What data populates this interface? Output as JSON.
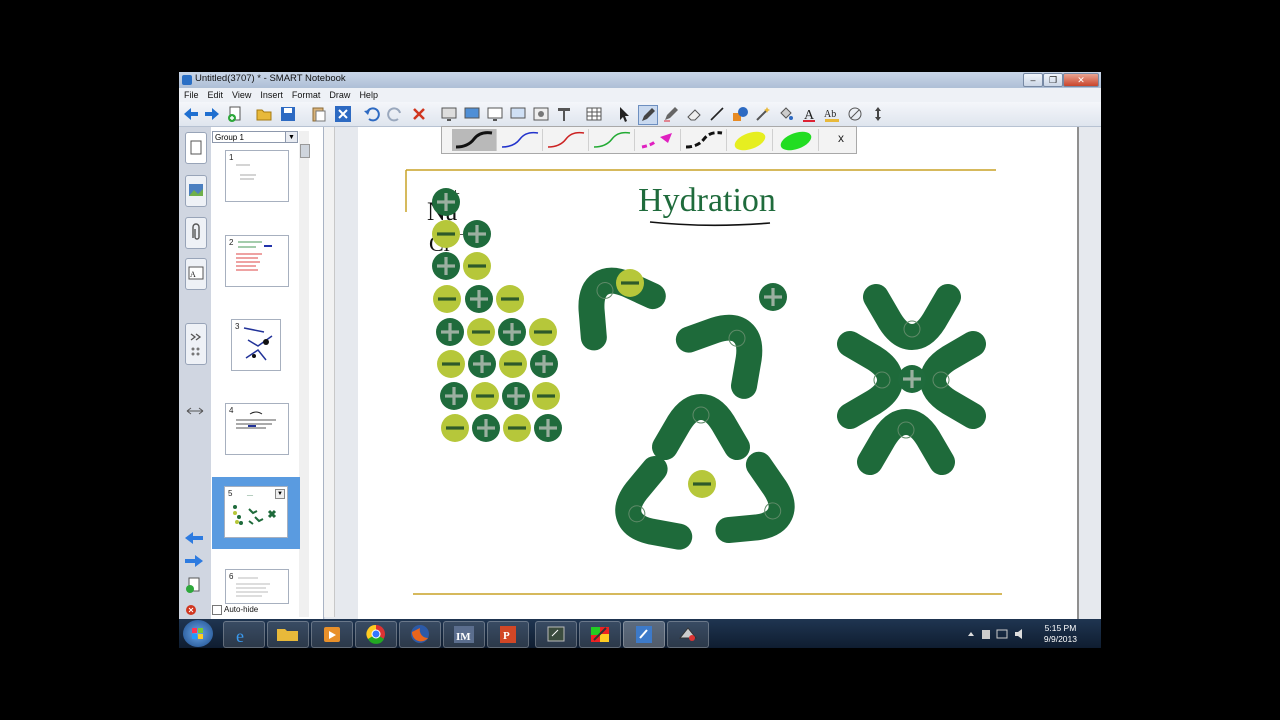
{
  "window": {
    "title": "Untitled(3707) * - SMART Notebook"
  },
  "menu": [
    "File",
    "Edit",
    "View",
    "Insert",
    "Format",
    "Draw",
    "Help"
  ],
  "sorter": {
    "group_label": "Group 1",
    "pages": [
      {
        "num": "1",
        "preview": "text"
      },
      {
        "num": "2",
        "preview": "text-colored"
      },
      {
        "num": "3",
        "preview": "diagram"
      },
      {
        "num": "4",
        "preview": "text"
      },
      {
        "num": "5",
        "preview": "hydration",
        "selected": true
      },
      {
        "num": "6",
        "preview": "text"
      }
    ],
    "autohide_label": "Auto-hide"
  },
  "pen_bar": {
    "close_label": "x",
    "pens": [
      {
        "name": "black-pen",
        "color": "#111111"
      },
      {
        "name": "blue-pen",
        "color": "#2233cc"
      },
      {
        "name": "red-pen",
        "color": "#cc2222"
      },
      {
        "name": "green-pen",
        "color": "#22aa33"
      },
      {
        "name": "magenta-creative-pen",
        "color": "#e020c0"
      },
      {
        "name": "black-dashed-pen",
        "color": "#111111"
      },
      {
        "name": "yellow-highlighter",
        "color": "#e6ee20"
      },
      {
        "name": "green-highlighter",
        "color": "#22dd22"
      }
    ]
  },
  "page": {
    "title": "Hydration",
    "handwriting_line1": "Na",
    "handwriting_line1_sup": "+",
    "handwriting_line2": "Cl",
    "handwriting_line2_sup": "−",
    "colors": {
      "positive": "#1f6b3c",
      "negative": "#b6c73a",
      "water": "#1e6a3a",
      "title": "#1f6b3c",
      "rule": "#c9a227"
    }
  },
  "taskbar": {
    "time": "5:15 PM",
    "date": "9/9/2013",
    "apps": [
      "start",
      "internet-explorer",
      "file-explorer",
      "media-player",
      "chrome",
      "firefox",
      "im",
      "powerpoint",
      "smart-board",
      "paint",
      "smart-notebook",
      "smart-tools"
    ]
  }
}
